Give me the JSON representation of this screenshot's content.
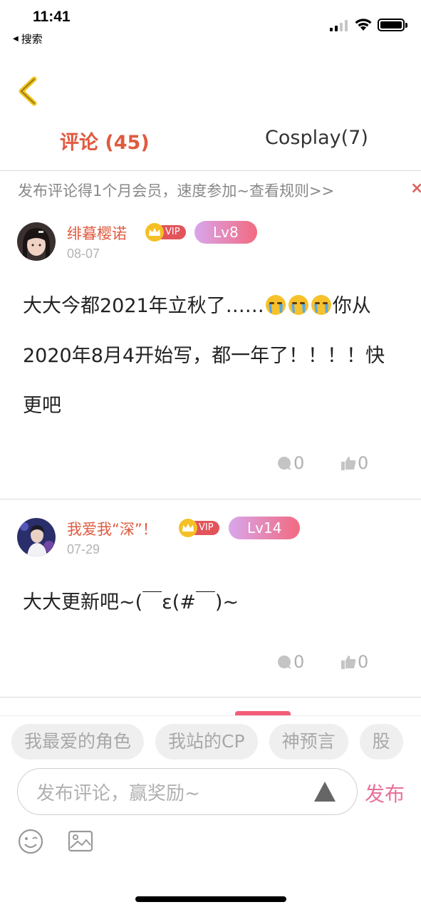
{
  "status": {
    "time": "11:41",
    "back_app": "搜索"
  },
  "tabs": {
    "comments": "评论 (45)",
    "cosplay": "Cosplay(7)"
  },
  "promo": {
    "text": "发布评论得1个月会员，速度参加~查看规则>>",
    "close": "×"
  },
  "comments": [
    {
      "username": "绯暮樱诺",
      "vip": "VIP",
      "level": "Lv8",
      "date": "08-07",
      "content_a": "大大今都2021年立秋了……",
      "content_b": "你从2020年8月4开始写，都一年了！！！！快更吧",
      "replies": "0",
      "likes": "0"
    },
    {
      "username": "我爱我“深”！",
      "vip": "VIP",
      "level": "Lv14",
      "date": "07-29",
      "content": "大大更新吧~(￣ε(#￣)~",
      "replies": "0",
      "likes": "0"
    }
  ],
  "chips": [
    "我最爱的角色",
    "我站的CP",
    "神预言",
    "股"
  ],
  "input": {
    "placeholder": "发布评论，赢奖励~",
    "publish": "发布"
  },
  "colors": {
    "accent": "#e05a3f",
    "publish": "#e9709b",
    "level_gradient": [
      "#d8a6ec",
      "#f26a80"
    ],
    "vip_crown": "#f5c026",
    "vip_tag": "#e2545a"
  }
}
